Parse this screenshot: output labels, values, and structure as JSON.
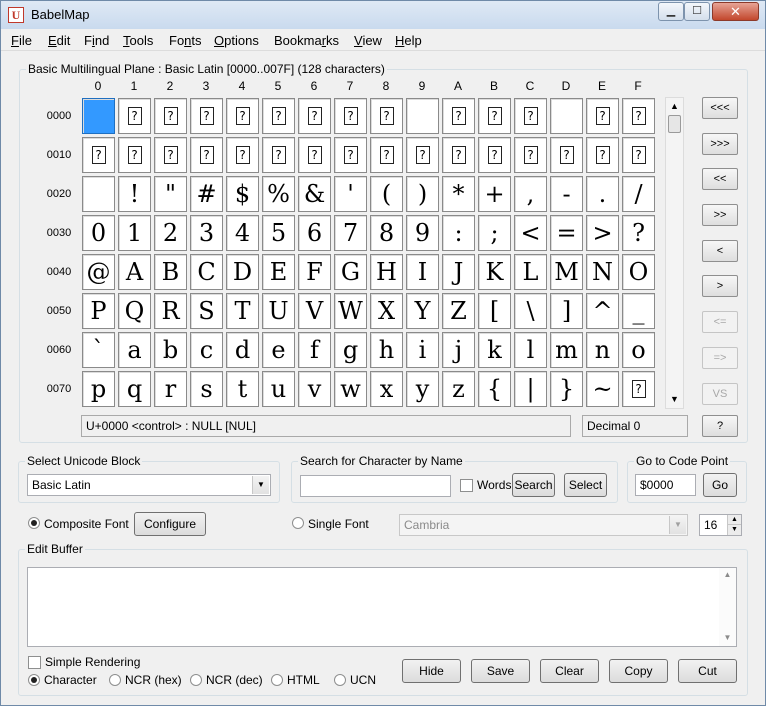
{
  "window": {
    "title": "BabelMap",
    "icon_letter": "U",
    "controls": {
      "min": "▁",
      "max": "☐",
      "close": "✕"
    }
  },
  "menu": [
    "File",
    "Edit",
    "Find",
    "Tools",
    "Fonts",
    "Options",
    "Bookmarks",
    "View",
    "Help"
  ],
  "menu_underline": [
    "F",
    "E",
    "i",
    "T",
    "n",
    "O",
    "r",
    "V",
    "H"
  ],
  "grid": {
    "label": "Basic Multilingual Plane : Basic Latin [0000..007F] (128 characters)",
    "columns": [
      "0",
      "1",
      "2",
      "3",
      "4",
      "5",
      "6",
      "7",
      "8",
      "9",
      "A",
      "B",
      "C",
      "D",
      "E",
      "F"
    ],
    "rows": [
      "0000",
      "0010",
      "0020",
      "0030",
      "0040",
      "0050",
      "0060",
      "0070"
    ],
    "chars": [
      [
        "",
        "⍰",
        "⍰",
        "⍰",
        "⍰",
        "⍰",
        "⍰",
        "⍰",
        "⍰",
        "",
        "⍰",
        "⍰",
        "⍰",
        "",
        "⍰",
        "⍰"
      ],
      [
        "⍰",
        "⍰",
        "⍰",
        "⍰",
        "⍰",
        "⍰",
        "⍰",
        "⍰",
        "⍰",
        "⍰",
        "⍰",
        "⍰",
        "⍰",
        "⍰",
        "⍰",
        "⍰"
      ],
      [
        "",
        "!",
        "\"",
        "#",
        "$",
        "%",
        "&",
        "'",
        "(",
        ")",
        "*",
        "+",
        ",",
        "-",
        ".",
        "/"
      ],
      [
        "0",
        "1",
        "2",
        "3",
        "4",
        "5",
        "6",
        "7",
        "8",
        "9",
        ":",
        ";",
        "<",
        "=",
        ">",
        "?"
      ],
      [
        "@",
        "A",
        "B",
        "C",
        "D",
        "E",
        "F",
        "G",
        "H",
        "I",
        "J",
        "K",
        "L",
        "M",
        "N",
        "O"
      ],
      [
        "P",
        "Q",
        "R",
        "S",
        "T",
        "U",
        "V",
        "W",
        "X",
        "Y",
        "Z",
        "[",
        "\\",
        "]",
        "^",
        "_"
      ],
      [
        "`",
        "a",
        "b",
        "c",
        "d",
        "e",
        "f",
        "g",
        "h",
        "i",
        "j",
        "k",
        "l",
        "m",
        "n",
        "o"
      ],
      [
        "p",
        "q",
        "r",
        "s",
        "t",
        "u",
        "v",
        "w",
        "x",
        "y",
        "z",
        "{",
        "|",
        "}",
        "~",
        "⍰"
      ]
    ],
    "selected_code": "0000",
    "status_text": "U+0000 <control> : NULL [NUL]",
    "decimal_text": "Decimal 0"
  },
  "nav_buttons": [
    "<<<",
    ">>>",
    "<<",
    ">>",
    "<",
    ">",
    "<=",
    "=>",
    "VS",
    "?"
  ],
  "nav_disabled": [
    false,
    false,
    false,
    false,
    false,
    false,
    true,
    true,
    true,
    false
  ],
  "block": {
    "label": "Select Unicode Block",
    "value": "Basic Latin"
  },
  "search": {
    "label": "Search for Character by Name",
    "value": "",
    "words_label": "Words",
    "search_btn": "Search",
    "select_btn": "Select"
  },
  "goto": {
    "label": "Go to Code Point",
    "value": "$0000",
    "go_btn": "Go"
  },
  "font": {
    "composite_label": "Composite Font",
    "configure_btn": "Configure",
    "single_label": "Single Font",
    "single_font_value": "Cambria",
    "size": "16"
  },
  "edit_buffer": {
    "label": "Edit Buffer",
    "simple_rendering_label": "Simple Rendering",
    "modes": [
      "Character",
      "NCR (hex)",
      "NCR (dec)",
      "HTML",
      "UCN"
    ],
    "buttons": [
      "Hide",
      "Save",
      "Clear",
      "Copy",
      "Cut"
    ]
  },
  "colors": {
    "selection": "#3399ff"
  },
  "icons": {
    "dropdown": "chevron-down-icon",
    "scroll_up": "arrow-up-icon",
    "scroll_down": "arrow-down-icon"
  }
}
